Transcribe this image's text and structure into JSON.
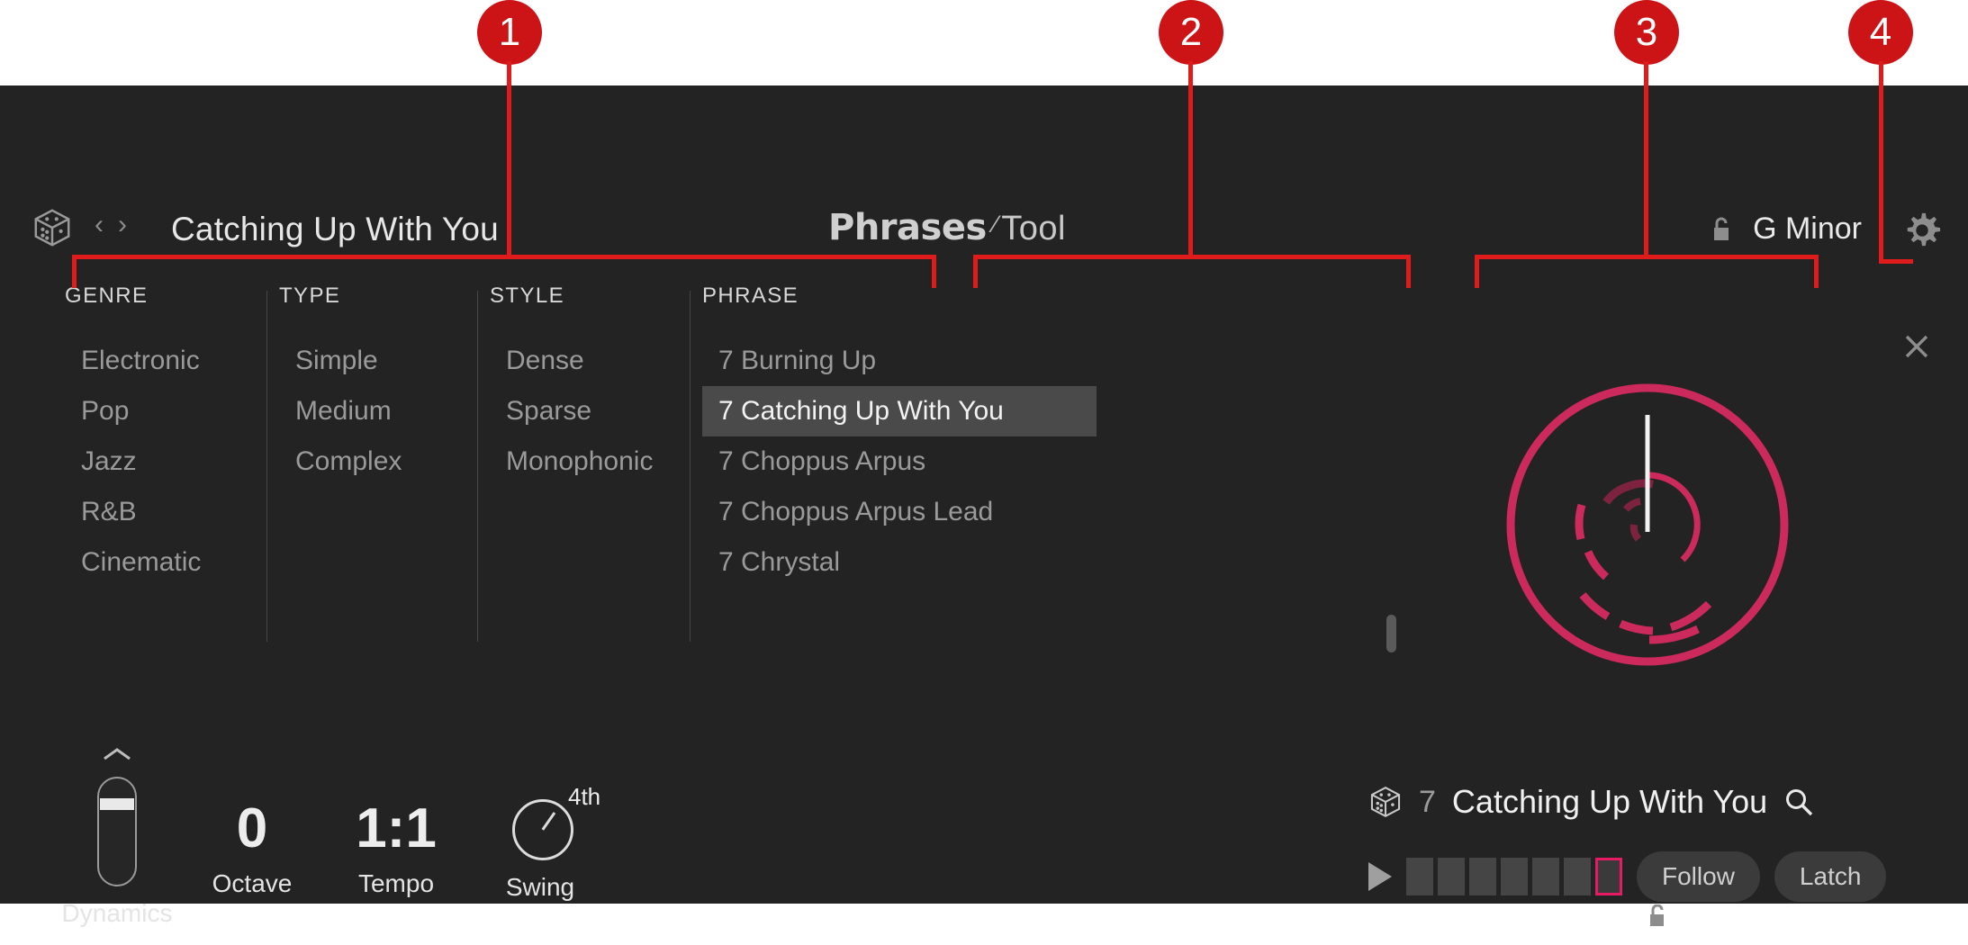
{
  "header": {
    "dice_icon": "dice-icon",
    "prev_label": "‹",
    "next_label": "›",
    "title": "Catching Up With You",
    "logo_primary": "Phrases",
    "logo_slash": "⁄",
    "logo_secondary": "Tool",
    "key_lock_icon": "unlock-icon",
    "key": "G Minor",
    "gear_icon": "gear-icon",
    "close_icon": "close-icon"
  },
  "browser": {
    "genre": {
      "title": "GENRE",
      "items": [
        "Electronic",
        "Pop",
        "Jazz",
        "R&B",
        "Cinematic"
      ]
    },
    "type": {
      "title": "TYPE",
      "items": [
        "Simple",
        "Medium",
        "Complex"
      ]
    },
    "style": {
      "title": "STYLE",
      "items": [
        "Dense",
        "Sparse",
        "Monophonic"
      ]
    },
    "phrase": {
      "title": "PHRASE",
      "items": [
        "7 Burning Up",
        "7 Catching Up With You",
        "7 Choppus Arpus",
        "7 Choppus Arpus Lead",
        "7 Chrystal"
      ],
      "selected_index": 1
    }
  },
  "visualizer": {
    "accent_color": "#cc2a5d",
    "playhead_color": "#f2f2f2",
    "name": "phrase-circle-visualizer"
  },
  "controls": {
    "dynamics": {
      "label": "Dynamics",
      "chevron_icon": "chevron-up-icon"
    },
    "octave": {
      "label": "Octave",
      "value": "0"
    },
    "tempo": {
      "label": "Tempo",
      "value": "1:1"
    },
    "swing": {
      "label": "Swing",
      "value": "4th",
      "knob_icon": "knob-icon"
    }
  },
  "player": {
    "dice_icon": "dice-icon",
    "number": "7",
    "name": "Catching Up With You",
    "search_icon": "search-icon",
    "play_icon": "play-icon",
    "steps": 7,
    "active_step": 7,
    "step_lock_icon": "unlock-icon",
    "follow_label": "Follow",
    "latch_label": "Latch",
    "active_step_color": "#e61b63"
  },
  "annotations": {
    "badges": [
      {
        "label": "1"
      },
      {
        "label": "2"
      },
      {
        "label": "3"
      },
      {
        "label": "4"
      }
    ],
    "color": "#cc1417"
  }
}
